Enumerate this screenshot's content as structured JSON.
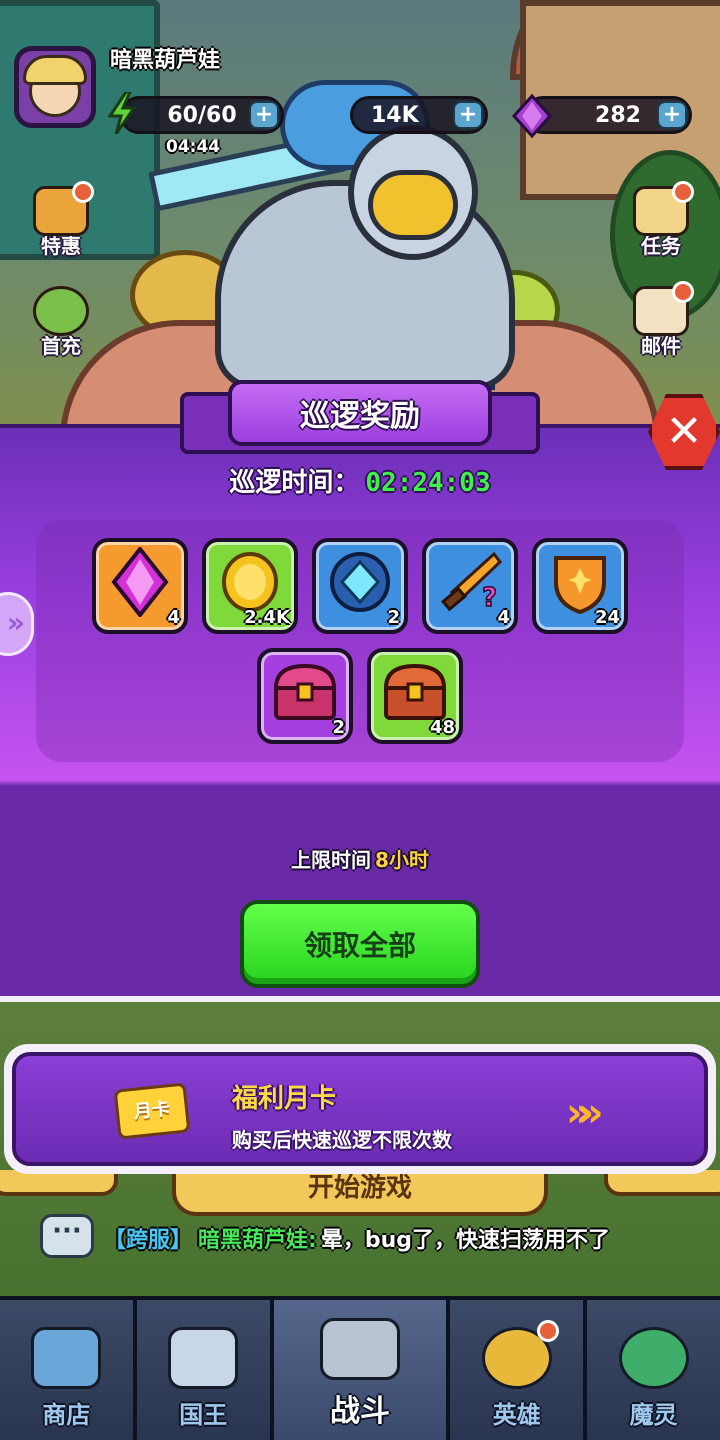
{
  "player": {
    "name": "暗黑葫芦娃"
  },
  "resources": {
    "energy": "60/60",
    "energy_timer": "04:44",
    "gold": "14K",
    "gems": "282"
  },
  "side_menu": {
    "special_offer": "特惠",
    "first_recharge": "首充",
    "quests": "任务",
    "mail": "邮件"
  },
  "modal": {
    "title": "巡逻奖励",
    "patrol_label": "巡逻时间：",
    "patrol_time": "02:24:03",
    "limit_label": "上限时间",
    "limit_value": "8小时",
    "claim_all": "领取全部",
    "close_icon": "close-icon",
    "rewards": [
      {
        "icon": "gem-icon",
        "count": "4",
        "bg": "#f59a2c"
      },
      {
        "icon": "gold-coin-icon",
        "count": "2.4K",
        "bg": "#7fd93a"
      },
      {
        "icon": "blue-gem-crest-icon",
        "count": "2",
        "bg": "#3f8fe0"
      },
      {
        "icon": "mystery-dagger-icon",
        "count": "4",
        "bg": "#3f8fe0"
      },
      {
        "icon": "gold-shield-icon",
        "count": "24",
        "bg": "#3f8fe0"
      },
      {
        "icon": "purple-chest-icon",
        "count": "2",
        "bg": "#a53fe0"
      },
      {
        "icon": "red-chest-icon",
        "count": "48",
        "bg": "#7fd93a"
      }
    ]
  },
  "month_card": {
    "icon_text": "月卡",
    "title": "福利月卡",
    "subtitle": "购买后快速巡逻不限次数"
  },
  "start_button": "开始游戏",
  "chat": {
    "channel": "【跨服】",
    "sender": "暗黑葫芦娃:",
    "message": "晕，bug了，快速扫荡用不了"
  },
  "nav": [
    {
      "label": "商店",
      "icon": "shop-icon"
    },
    {
      "label": "国王",
      "icon": "castle-icon"
    },
    {
      "label": "战斗",
      "icon": "battle-icon"
    },
    {
      "label": "英雄",
      "icon": "hero-helmet-icon"
    },
    {
      "label": "魔灵",
      "icon": "demon-icon"
    }
  ],
  "colors": {
    "panel_purple": "#9a3fe0",
    "timer_green": "#3ff04a",
    "limit_yellow": "#ffd43a",
    "claim_green": "#27d31f",
    "close_red": "#e2382e"
  }
}
